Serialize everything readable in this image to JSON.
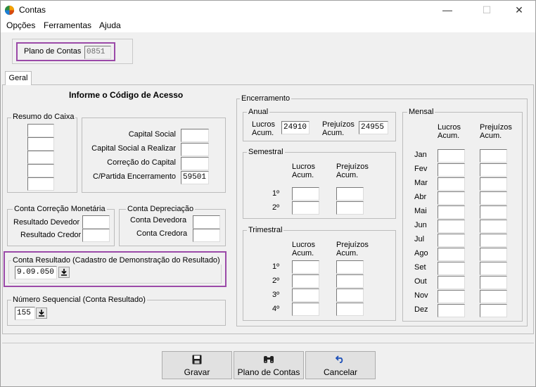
{
  "window": {
    "title": "Contas",
    "minimize": "—",
    "maximize": "☐",
    "close": "✕"
  },
  "menu": [
    {
      "label": "Opções"
    },
    {
      "label": "Ferramentas"
    },
    {
      "label": "Ajuda"
    }
  ],
  "plano": {
    "label": "Plano de Contas",
    "value": "0851"
  },
  "tab": {
    "label": "Geral"
  },
  "heading": "Informe o Código de Acesso",
  "resumo_caixa": {
    "label": "Resumo do Caixa"
  },
  "capital": {
    "capital_social": {
      "label": "Capital Social",
      "value": ""
    },
    "capital_realizar": {
      "label": "Capital Social a Realizar",
      "value": ""
    },
    "correcao_capital": {
      "label": "Correção do Capital",
      "value": ""
    },
    "cpartida": {
      "label": "C/Partida Encerramento",
      "value": "59501"
    }
  },
  "correcao_monetaria": {
    "label": "Conta Correção Monetária",
    "devedor": "Resultado Devedor",
    "credor": "Resultado Credor"
  },
  "depreciacao": {
    "label": "Conta Depreciação",
    "devedora": "Conta Devedora",
    "credora": "Conta Credora"
  },
  "conta_resultado": {
    "label": "Conta Resultado (Cadastro de Demonstração do Resultado)",
    "value": "9.09.050"
  },
  "numero_sequencial": {
    "label": "Número Sequencial (Conta Resultado)",
    "value": "155"
  },
  "encerramento": {
    "label": "Encerramento",
    "anual": {
      "label": "Anual",
      "lucros": "Lucros\nAcum.",
      "lucros_value": "24910",
      "prejuizos": "Prejuízos\nAcum.",
      "prejuizos_value": "24955"
    },
    "semestral": {
      "label": "Semestral",
      "lucros": "Lucros\nAcum.",
      "prejuizos": "Prejuízos\nAcum.",
      "rows": [
        "1º",
        "2º"
      ]
    },
    "trimestral": {
      "label": "Trimestral",
      "lucros": "Lucros\nAcum.",
      "prejuizos": "Prejuízos\nAcum.",
      "rows": [
        "1º",
        "2º",
        "3º",
        "4º"
      ]
    },
    "mensal": {
      "label": "Mensal",
      "lucros": "Lucros\nAcum.",
      "prejuizos": "Prejuízos\nAcum.",
      "months": [
        "Jan",
        "Fev",
        "Mar",
        "Abr",
        "Mai",
        "Jun",
        "Jul",
        "Ago",
        "Set",
        "Out",
        "Nov",
        "Dez"
      ]
    }
  },
  "buttons": {
    "gravar": {
      "label": "Gravar",
      "icon": "save-icon"
    },
    "plano": {
      "label": "Plano de Contas",
      "icon": "binoculars-icon"
    },
    "cancelar": {
      "label": "Cancelar",
      "icon": "undo-icon"
    }
  }
}
